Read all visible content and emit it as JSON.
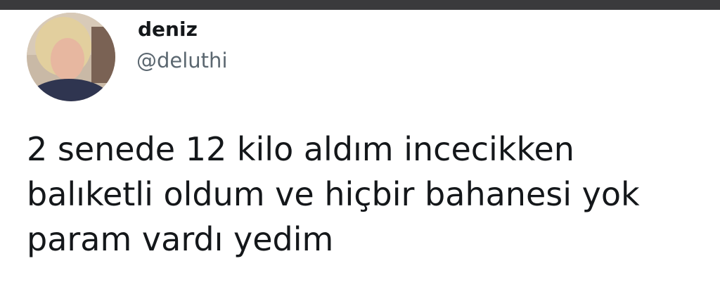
{
  "tweet": {
    "display_name": "deniz",
    "handle": "@deluthi",
    "text_lines": [
      "2 senede 12 kilo aldım incecikken",
      "balıketli oldum ve hiçbir bahanesi yok",
      "param vardı yedim"
    ]
  },
  "icons": {
    "avatar": "profile-photo"
  },
  "colors": {
    "top_bar": "#3a3a3c",
    "name_text": "#14171a",
    "handle_text": "#5b6770",
    "body_text": "#14171a"
  }
}
